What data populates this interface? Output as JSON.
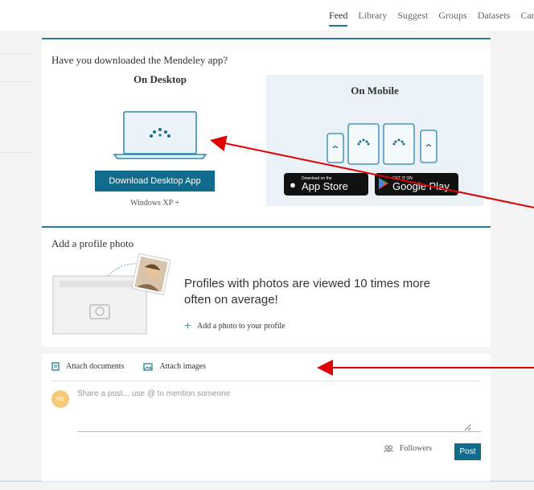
{
  "nav": {
    "items": [
      "Feed",
      "Library",
      "Suggest",
      "Groups",
      "Datasets",
      "Care"
    ],
    "active": "Feed"
  },
  "app_card": {
    "title": "Have you downloaded the Mendeley app?",
    "desktop": {
      "heading": "On Desktop",
      "button_label": "Download Desktop App",
      "requirement": "Windows XP +"
    },
    "mobile": {
      "heading": "On Mobile",
      "app_store": {
        "small": "Download on the",
        "big": "App Store"
      },
      "google_play": {
        "small": "GET IT ON",
        "big": "Google Play"
      }
    }
  },
  "photo_card": {
    "title": "Add a profile photo",
    "message": "Profiles with photos are viewed 10 times more often on average!",
    "add_link": "Add a photo to your profile"
  },
  "post_card": {
    "attach_documents": "Attach documents",
    "attach_images": "Attach images",
    "avatar_initials": "RE",
    "placeholder": "Share a post... use @ to mention someone",
    "followers_label": "Followers",
    "post_label": "Post"
  },
  "colors": {
    "accent": "#106b8c",
    "card_border": "#2a7aa1",
    "annotation_arrow": "#e00000",
    "avatar": "#f6c97a"
  },
  "icons": [
    "mendeley-logo-icon",
    "apple-icon",
    "google-play-icon",
    "camera-icon",
    "plus-icon",
    "attach-document-icon",
    "attach-image-icon",
    "followers-icon"
  ]
}
